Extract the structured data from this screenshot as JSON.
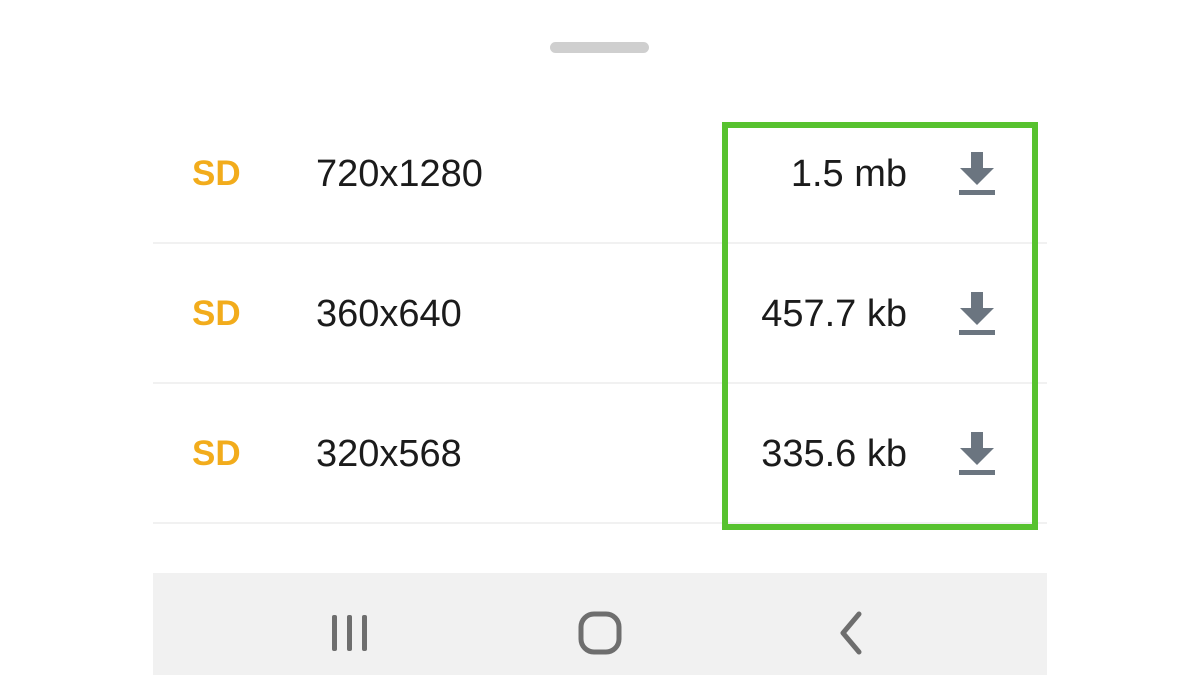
{
  "sheet": {
    "rows": [
      {
        "quality": "SD",
        "resolution": "720x1280",
        "size": "1.5 mb",
        "icon": "download-icon"
      },
      {
        "quality": "SD",
        "resolution": "360x640",
        "size": "457.7 kb",
        "icon": "download-icon"
      },
      {
        "quality": "SD",
        "resolution": "320x568",
        "size": "335.6 kb",
        "icon": "download-icon"
      }
    ]
  },
  "colors": {
    "quality_label": "#f2ac1c",
    "highlight_border": "#57c22f",
    "icon": "#6b7580",
    "nav_background": "#f1f1f1"
  },
  "nav_bar": {
    "buttons": [
      "recent-apps-icon",
      "home-icon",
      "back-icon"
    ]
  }
}
